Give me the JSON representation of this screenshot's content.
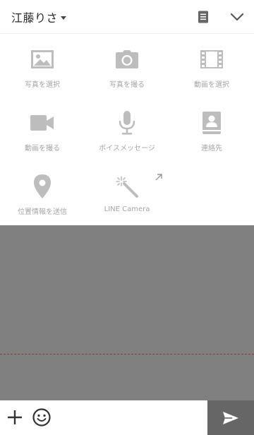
{
  "header": {
    "chat_name": "江藤りさ",
    "icons": {
      "note": "note-icon",
      "collapse": "chevron-down-icon"
    }
  },
  "menu": {
    "items": [
      {
        "label": "写真を選択",
        "icon": "image-icon"
      },
      {
        "label": "写真を撮る",
        "icon": "camera-icon"
      },
      {
        "label": "動画を選択",
        "icon": "film-icon"
      },
      {
        "label": "動画を撮る",
        "icon": "video-camera-icon"
      },
      {
        "label": "ボイスメッセージ",
        "icon": "microphone-icon"
      },
      {
        "label": "連絡先",
        "icon": "contacts-icon"
      },
      {
        "label": "位置情報を送信",
        "icon": "location-pin-icon"
      },
      {
        "label": "LINE Camera",
        "icon": "magic-wand-icon"
      }
    ]
  },
  "input": {
    "placeholder": "",
    "icons": {
      "add": "plus-icon",
      "emoji": "smiley-icon",
      "send": "send-icon"
    }
  },
  "colors": {
    "chat_background": "#808080",
    "menu_icon": "#bdbdbd",
    "menu_label": "#a6a6a6",
    "send_button": "#666666",
    "unread_divider": "#8e3a30"
  }
}
